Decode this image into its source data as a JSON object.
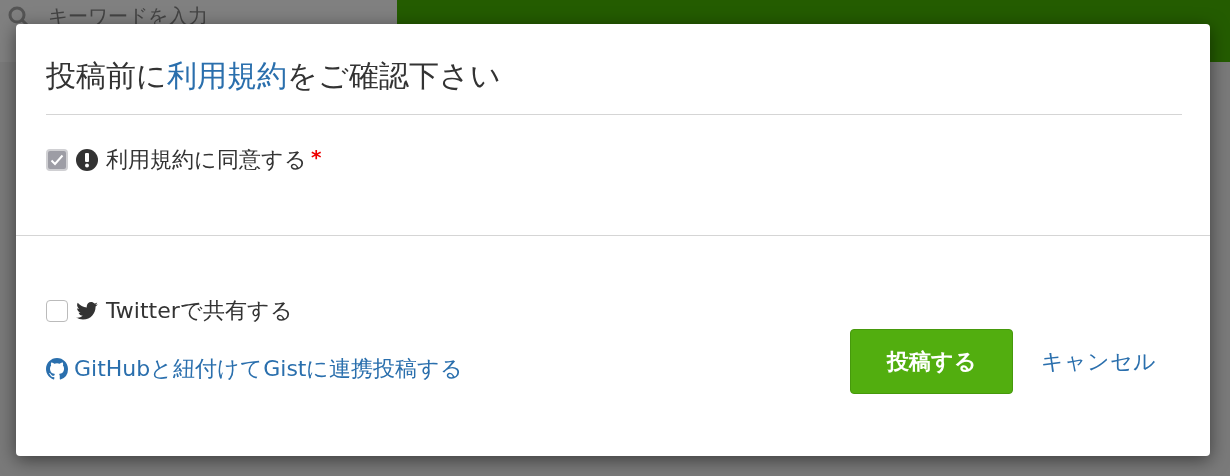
{
  "background": {
    "search": {
      "placeholder": "キーワードを入力"
    }
  },
  "dialog": {
    "title": {
      "before": "投稿前に",
      "link": "利用規約",
      "after": "をご確認下さい"
    },
    "agree": {
      "label": "利用規約に同意する",
      "checked": true,
      "disabled": true,
      "required": true,
      "required_mark": "*"
    },
    "share": {
      "label": "Twitterで共有する",
      "checked": false
    },
    "github_link": "GitHubと紐付けてGistに連携投稿する",
    "buttons": [
      {
        "kind": "primary",
        "label": "投稿する"
      },
      {
        "kind": "link",
        "label": "キャンセル"
      }
    ]
  }
}
